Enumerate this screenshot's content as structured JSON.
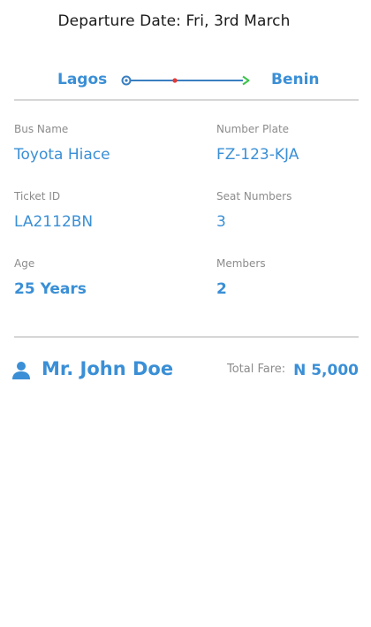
{
  "departure": {
    "text": "Departure Date: Fri, 3rd March"
  },
  "route": {
    "from": "Lagos",
    "to": "Benin",
    "start_icon": "origin-ring-icon",
    "mid_icon": "midpoint-dot-icon",
    "end_icon": "arrowhead-icon",
    "colors": {
      "line": "#3a7fc1",
      "mid_dot": "#e53935",
      "arrow": "#3cc44a"
    }
  },
  "ticket": {
    "bus_name_label": "Bus Name",
    "bus_name": "Toyota Hiace",
    "number_plate_label": "Number Plate",
    "number_plate": "FZ-123-KJA",
    "ticket_id_label": "Ticket ID",
    "ticket_id": "LA2112BN",
    "seat_numbers_label": "Seat Numbers",
    "seat_numbers": "3",
    "age_label": "Age",
    "age": "25 Years",
    "members_label": "Members",
    "members": "2"
  },
  "passenger": {
    "icon": "person-icon",
    "name": "Mr. John Doe",
    "total_fare_label": "Total Fare:",
    "total_fare": "N 5,000"
  },
  "colors": {
    "accent": "#3a8fd6",
    "label": "#8c8c8c",
    "divider": "#d6d6d6"
  }
}
